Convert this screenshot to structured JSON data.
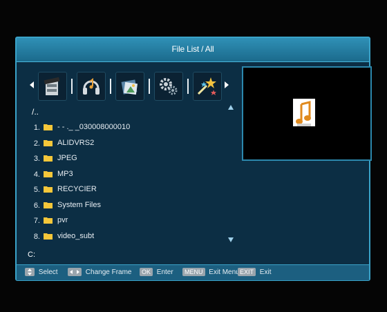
{
  "window": {
    "title": "File List / All"
  },
  "categories": [
    {
      "icon": "movie-icon"
    },
    {
      "icon": "music-icon"
    },
    {
      "icon": "picture-icon"
    },
    {
      "icon": "settings-icon"
    },
    {
      "icon": "stars-icon"
    }
  ],
  "file_list": {
    "path": "/..",
    "items": [
      {
        "number": "1.",
        "name": "- - ._ _030008000010"
      },
      {
        "number": "2.",
        "name": "ALIDVRS2"
      },
      {
        "number": "3.",
        "name": "JPEG"
      },
      {
        "number": "4.",
        "name": "MP3"
      },
      {
        "number": "5.",
        "name": "RECYCIER"
      },
      {
        "number": "6.",
        "name": "System Files"
      },
      {
        "number": "7.",
        "name": "pvr"
      },
      {
        "number": "8.",
        "name": "video_subt"
      }
    ],
    "drive": "C:"
  },
  "preview": {
    "icon": "music-file-icon"
  },
  "help_bar": {
    "select": {
      "key": "",
      "label": "Select"
    },
    "change_frame": {
      "key": "",
      "label": "Change Frame"
    },
    "enter": {
      "key": "OK",
      "label": "Enter"
    },
    "exit_menu": {
      "key": "MENU",
      "label": "Exit Menu"
    },
    "exit": {
      "key": "EXIT",
      "label": "Exit"
    }
  },
  "colors": {
    "panel": "#0c2e44",
    "border": "#3aa3c9",
    "folder": "#f5c73a",
    "helpbar": "#1c5f80"
  }
}
